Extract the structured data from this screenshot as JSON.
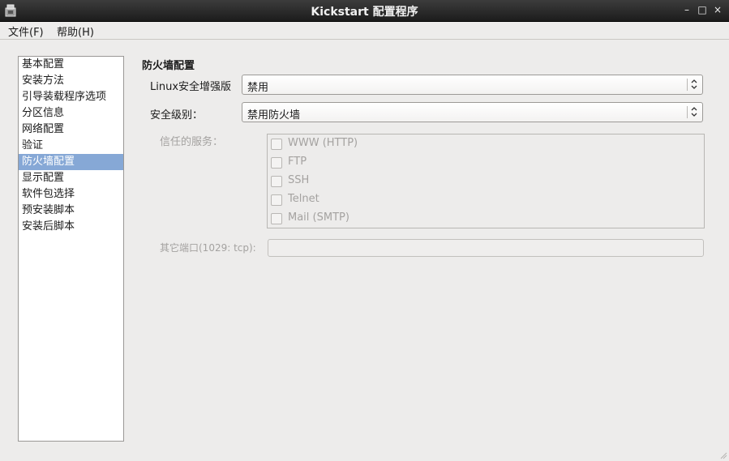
{
  "window": {
    "title": "Kickstart 配置程序",
    "min_glyph": "–",
    "max_glyph": "□",
    "close_glyph": "×"
  },
  "menu": {
    "file": "文件(F)",
    "help": "帮助(H)"
  },
  "sidebar": {
    "items": [
      {
        "label": "基本配置"
      },
      {
        "label": "安装方法"
      },
      {
        "label": "引导装载程序选项"
      },
      {
        "label": "分区信息"
      },
      {
        "label": "网络配置"
      },
      {
        "label": "验证"
      },
      {
        "label": "防火墙配置",
        "selected": true
      },
      {
        "label": "显示配置"
      },
      {
        "label": "软件包选择"
      },
      {
        "label": "预安装脚本"
      },
      {
        "label": "安装后脚本"
      }
    ]
  },
  "firewall": {
    "section_title": "防火墙配置",
    "selinux": {
      "label": "Linux安全增强版",
      "value": "禁用"
    },
    "security_level": {
      "label": "安全级别：",
      "value": "禁用防火墙"
    },
    "trusted_services": {
      "label": "信任的服务：",
      "enabled": false,
      "items": [
        {
          "label": "WWW (HTTP)",
          "checked": false
        },
        {
          "label": "FTP",
          "checked": false
        },
        {
          "label": "SSH",
          "checked": false
        },
        {
          "label": "Telnet",
          "checked": false
        },
        {
          "label": "Mail (SMTP)",
          "checked": false
        }
      ]
    },
    "other_ports": {
      "label": "其它端口(1029: tcp):",
      "value": "",
      "enabled": false
    }
  },
  "colors": {
    "selection": "#86a8d6",
    "titlebar": "#262626",
    "window_bg": "#edeceb",
    "disabled_text": "#a4a2a0"
  }
}
